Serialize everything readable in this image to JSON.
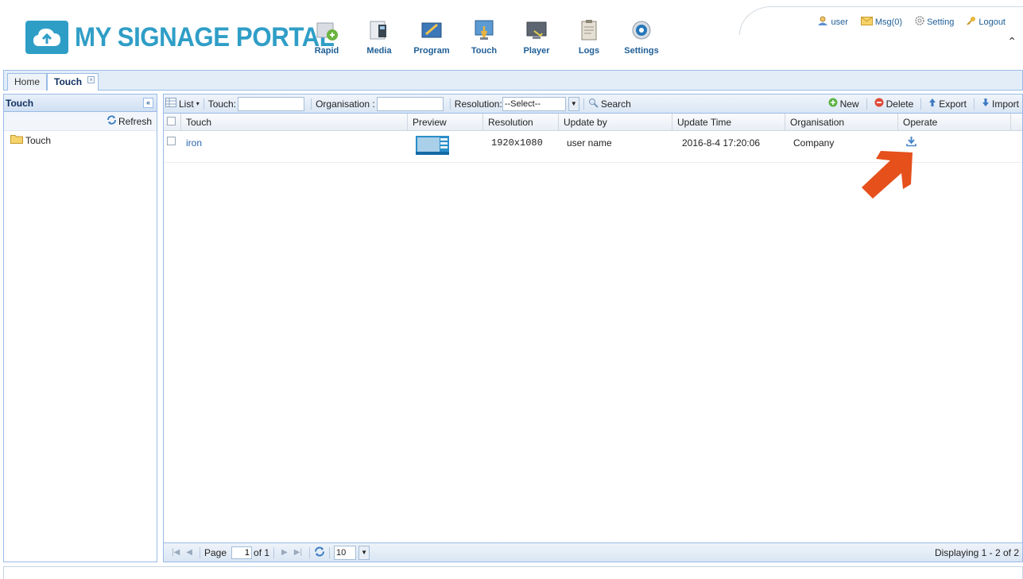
{
  "brand": {
    "name": "MY SIGNAGE PORTAL",
    "color": "#2f9ec7"
  },
  "nav": [
    {
      "label": "Rapid",
      "icon": "rapid-icon"
    },
    {
      "label": "Media",
      "icon": "media-icon"
    },
    {
      "label": "Program",
      "icon": "program-icon"
    },
    {
      "label": "Touch",
      "icon": "touch-icon"
    },
    {
      "label": "Player",
      "icon": "player-icon"
    },
    {
      "label": "Logs",
      "icon": "logs-icon"
    },
    {
      "label": "Settings",
      "icon": "settings-icon"
    }
  ],
  "top_links": {
    "user": "user",
    "msg": "Msg(0)",
    "setting": "Setting",
    "logout": "Logout"
  },
  "tabs": {
    "home": "Home",
    "touch": "Touch"
  },
  "left_panel": {
    "title": "Touch",
    "refresh": "Refresh",
    "tree_item": "Touch"
  },
  "toolbar": {
    "list": "List",
    "touch_label": "Touch:",
    "touch_value": "",
    "org_label": "Organisation :",
    "org_value": "",
    "resolution_label": "Resolution:",
    "resolution_value": "--Select--",
    "search": "Search",
    "new": "New",
    "delete": "Delete",
    "export": "Export",
    "import": "Import"
  },
  "grid": {
    "columns": [
      "Touch",
      "Preview",
      "Resolution",
      "Update by",
      "Update Time",
      "Organisation",
      "Operate"
    ],
    "rows": [
      {
        "touch": "iron",
        "resolution": "1920x1080",
        "update_by": "user name",
        "update_time": "2016-8-4 17:20:06",
        "organisation": "Company"
      }
    ]
  },
  "pager": {
    "page_label": "Page",
    "page": "1",
    "of": "of 1",
    "page_size": "10",
    "info": "Displaying 1 - 2 of 2"
  },
  "colors": {
    "accent": "#2f9ec7",
    "panel_border": "#99bbe8",
    "arrow": "#e5501b",
    "link": "#1e5e96"
  }
}
